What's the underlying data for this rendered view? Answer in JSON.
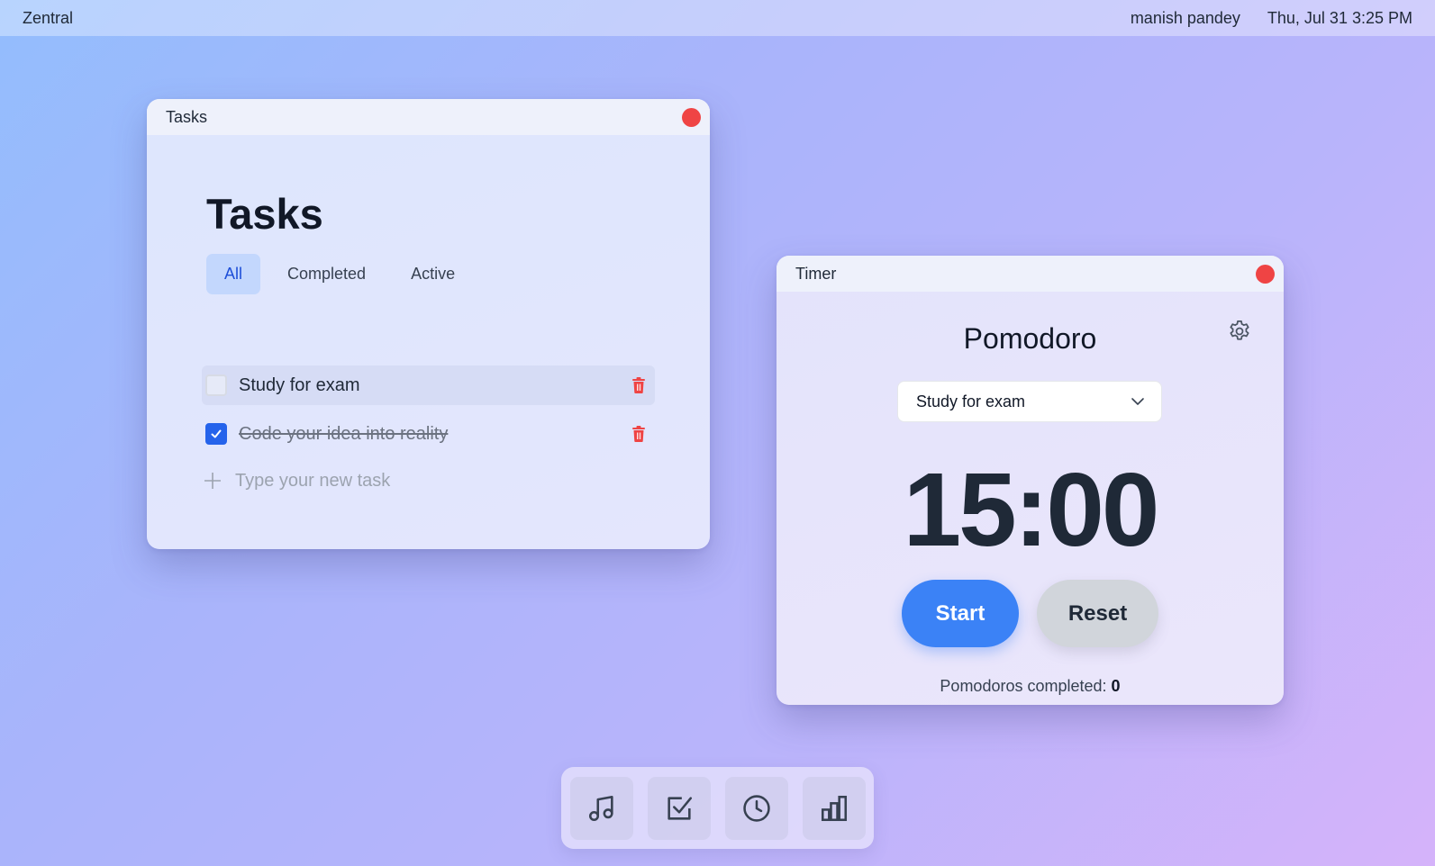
{
  "topbar": {
    "app_name": "Zentral",
    "user_name": "manish pandey",
    "datetime": "Thu, Jul 31 3:25 PM"
  },
  "tasks_window": {
    "title": "Tasks",
    "heading": "Tasks",
    "filters": [
      {
        "label": "All",
        "active": true
      },
      {
        "label": "Completed",
        "active": false
      },
      {
        "label": "Active",
        "active": false
      }
    ],
    "tasks": [
      {
        "text": "Study for exam",
        "completed": false
      },
      {
        "text": "Code your idea into reality",
        "completed": true
      }
    ],
    "new_task_placeholder": "Type your new task"
  },
  "timer_window": {
    "title": "Timer",
    "heading": "Pomodoro",
    "selected_task": "Study for exam",
    "time": "15:00",
    "start_label": "Start",
    "reset_label": "Reset",
    "pomodoros_label": "Pomodoros completed:",
    "pomodoros_count": "0"
  },
  "dock": {
    "items": [
      {
        "icon": "music-note-icon"
      },
      {
        "icon": "checkbox-icon"
      },
      {
        "icon": "clock-icon"
      },
      {
        "icon": "bar-chart-icon"
      }
    ]
  },
  "colors": {
    "accent": "#3b82f6",
    "close": "#ef4444",
    "delete": "#ef4444"
  }
}
